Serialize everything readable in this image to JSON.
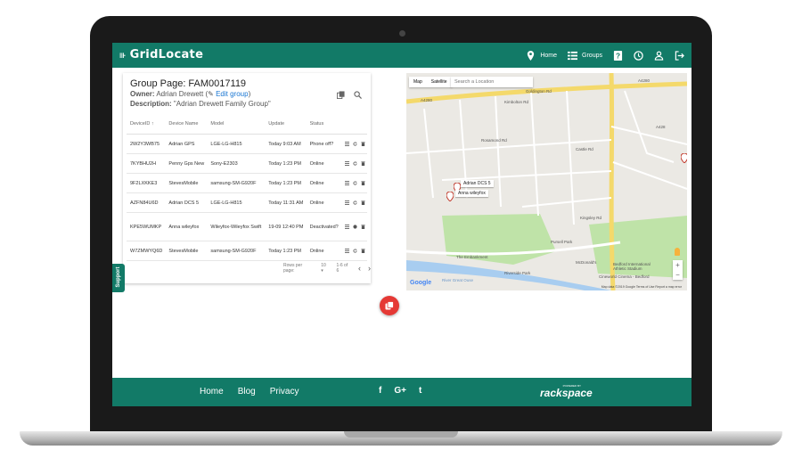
{
  "header": {
    "logo": "GridLocate",
    "nav": [
      {
        "label": "Home",
        "icon": "location-pin-icon"
      },
      {
        "label": "Groups",
        "icon": "list-icon"
      },
      {
        "label": "",
        "icon": "help-icon"
      },
      {
        "label": "",
        "icon": "clock-icon"
      },
      {
        "label": "",
        "icon": "user-icon"
      },
      {
        "label": "",
        "icon": "logout-icon"
      }
    ]
  },
  "group": {
    "title": "Group Page: FAM0017119",
    "owner_label": "Owner:",
    "owner_name": "Adrian Drewett",
    "edit_label": "Edit group",
    "description_label": "Description:",
    "description": "\"Adrian Drewett Family Group\""
  },
  "table": {
    "columns": [
      "DeviceID",
      "Device Name",
      "Model",
      "Update",
      "Status"
    ],
    "sort_indicator": "↑",
    "rows": [
      {
        "id": "2W2Y3WB75",
        "name": "Adrian GPS",
        "model": "LGE-LG-H815",
        "update": "Today 9:03 AM",
        "status": "Phone off?"
      },
      {
        "id": "7KYBHU2H",
        "name": "Penny Gps New",
        "model": "Sony-E2303",
        "update": "Today 1:23 PM",
        "status": "Online"
      },
      {
        "id": "9F2LXKKE3",
        "name": "StevesMobile",
        "model": "samsung-SM-G920F",
        "update": "Today 1:23 PM",
        "status": "Online"
      },
      {
        "id": "AZFN84U6D",
        "name": "Adrian DCS 5",
        "model": "LGE-LG-H815",
        "update": "Today 11:31 AM",
        "status": "Online"
      },
      {
        "id": "KPE5WUMKP",
        "name": "Anna wileyfox",
        "model": "Wileyfox-Wileyfox Swift",
        "update": "19-09 12:40 PM",
        "status": "Deactivated?"
      },
      {
        "id": "W7ZMWYQ6D",
        "name": "StevesMobile",
        "model": "samsung-SM-G920F",
        "update": "Today 1:23 PM",
        "status": "Online"
      }
    ]
  },
  "pager": {
    "rows_label": "Rows per page:",
    "rows_value": "10 ▾",
    "range": "1-6 of 6",
    "prev": "‹",
    "next": "›"
  },
  "support_label": "Support",
  "map": {
    "tab_map": "Map",
    "tab_satellite": "Satellite",
    "search_placeholder": "Search a Location",
    "markers": [
      "Adrian DCS 5",
      "Anna wileyfox"
    ],
    "streets": [
      "Goldington Rd",
      "A4280",
      "A428",
      "Castle Rd",
      "Rosamond Rd",
      "Kimbolton Rd",
      "Pursell Park",
      "The Embankment",
      "Riverside Park",
      "Kingsley Rd",
      "McDonald's",
      "Bedford International Athletic Stadium",
      "Cineworld Cinema - Bedford",
      "River Great Ouse"
    ],
    "google": "Google",
    "copyright": "Map data ©2019 Google   Terms of Use   Report a map error",
    "zoom_in": "+",
    "zoom_out": "−"
  },
  "footer": {
    "links": [
      "Home",
      "Blog",
      "Privacy"
    ],
    "social": [
      "f",
      "G+",
      "t"
    ],
    "powered_by": "POWERED BY",
    "rackspace": "rackspace"
  },
  "colors": {
    "brand": "#127a67",
    "fab": "#e53935",
    "link": "#1976d2"
  }
}
